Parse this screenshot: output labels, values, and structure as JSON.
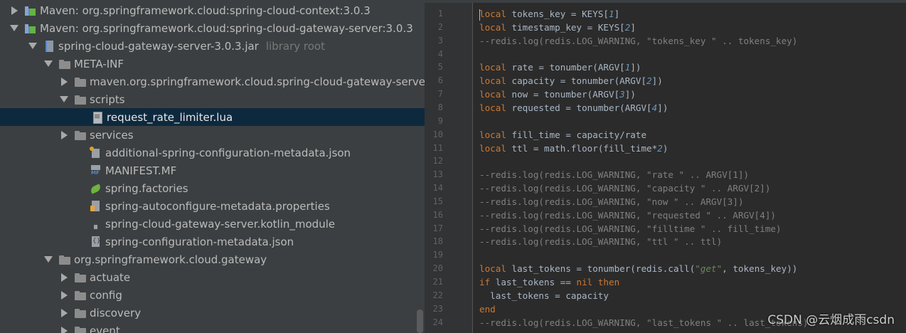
{
  "tree": {
    "rows": [
      {
        "arrow": "collapsed",
        "icon": "library-icon",
        "label": "Maven: org.springframework.cloud:spring-cloud-context:3.0.3",
        "hint": ""
      },
      {
        "arrow": "expanded",
        "icon": "library-icon",
        "label": "Maven: org.springframework.cloud:spring-cloud-gateway-server:3.0.3",
        "hint": ""
      },
      {
        "arrow": "expanded",
        "icon": "jar-icon",
        "label": "spring-cloud-gateway-server-3.0.3.jar",
        "hint": "library root"
      },
      {
        "arrow": "expanded",
        "icon": "folder-icon",
        "label": "META-INF",
        "hint": ""
      },
      {
        "arrow": "collapsed",
        "icon": "folder-icon",
        "label": "maven.org.springframework.cloud.spring-cloud-gateway-server",
        "hint": ""
      },
      {
        "arrow": "expanded",
        "icon": "folder-icon",
        "label": "scripts",
        "hint": ""
      },
      {
        "arrow": "none",
        "icon": "lua-file-icon",
        "label": "request_rate_limiter.lua",
        "hint": "",
        "selected": true
      },
      {
        "arrow": "collapsed",
        "icon": "folder-icon",
        "label": "services",
        "hint": ""
      },
      {
        "arrow": "none",
        "icon": "json-file-icon",
        "label": "additional-spring-configuration-metadata.json",
        "hint": ""
      },
      {
        "arrow": "none",
        "icon": "manifest-file-icon",
        "label": "MANIFEST.MF",
        "hint": ""
      },
      {
        "arrow": "none",
        "icon": "spring-factories-icon",
        "label": "spring.factories",
        "hint": ""
      },
      {
        "arrow": "none",
        "icon": "properties-file-icon",
        "label": "spring-autoconfigure-metadata.properties",
        "hint": ""
      },
      {
        "arrow": "none",
        "icon": "kotlin-module-file-icon",
        "label": "spring-cloud-gateway-server.kotlin_module",
        "hint": ""
      },
      {
        "arrow": "none",
        "icon": "json-config-file-icon",
        "label": "spring-configuration-metadata.json",
        "hint": ""
      },
      {
        "arrow": "expanded",
        "icon": "package-icon",
        "label": "org.springframework.cloud.gateway",
        "hint": ""
      },
      {
        "arrow": "collapsed",
        "icon": "folder-icon",
        "label": "actuate",
        "hint": ""
      },
      {
        "arrow": "collapsed",
        "icon": "folder-icon",
        "label": "config",
        "hint": ""
      },
      {
        "arrow": "collapsed",
        "icon": "folder-icon",
        "label": "discovery",
        "hint": ""
      },
      {
        "arrow": "collapsed",
        "icon": "folder-icon",
        "label": "event",
        "hint": ""
      }
    ]
  },
  "editor": {
    "lines": [
      [
        [
          "k",
          "local"
        ],
        [
          "t",
          " tokens_key = KEYS["
        ],
        [
          "n",
          "1"
        ],
        [
          "t",
          "]"
        ]
      ],
      [
        [
          "k",
          "local"
        ],
        [
          "t",
          " timestamp_key = KEYS["
        ],
        [
          "n",
          "2"
        ],
        [
          "t",
          "]"
        ]
      ],
      [
        [
          "c",
          "--redis.log(redis.LOG_WARNING, \"tokens_key \" .. tokens_key)"
        ]
      ],
      [],
      [
        [
          "k",
          "local"
        ],
        [
          "t",
          " rate = tonumber(ARGV["
        ],
        [
          "n",
          "1"
        ],
        [
          "t",
          "])"
        ]
      ],
      [
        [
          "k",
          "local"
        ],
        [
          "t",
          " capacity = tonumber(ARGV["
        ],
        [
          "n",
          "2"
        ],
        [
          "t",
          "])"
        ]
      ],
      [
        [
          "k",
          "local"
        ],
        [
          "t",
          " now = tonumber(ARGV["
        ],
        [
          "n",
          "3"
        ],
        [
          "t",
          "])"
        ]
      ],
      [
        [
          "k",
          "local"
        ],
        [
          "t",
          " requested = tonumber(ARGV["
        ],
        [
          "n",
          "4"
        ],
        [
          "t",
          "])"
        ]
      ],
      [],
      [
        [
          "k",
          "local"
        ],
        [
          "t",
          " fill_time = capacity/rate"
        ]
      ],
      [
        [
          "k",
          "local"
        ],
        [
          "t",
          " ttl = math.floor(fill_time*"
        ],
        [
          "n",
          "2"
        ],
        [
          "t",
          ")"
        ]
      ],
      [],
      [
        [
          "c",
          "--redis.log(redis.LOG_WARNING, \"rate \" .. ARGV[1])"
        ]
      ],
      [
        [
          "c",
          "--redis.log(redis.LOG_WARNING, \"capacity \" .. ARGV[2])"
        ]
      ],
      [
        [
          "c",
          "--redis.log(redis.LOG_WARNING, \"now \" .. ARGV[3])"
        ]
      ],
      [
        [
          "c",
          "--redis.log(redis.LOG_WARNING, \"requested \" .. ARGV[4])"
        ]
      ],
      [
        [
          "c",
          "--redis.log(redis.LOG_WARNING, \"filltime \" .. fill_time)"
        ]
      ],
      [
        [
          "c",
          "--redis.log(redis.LOG_WARNING, \"ttl \" .. ttl)"
        ]
      ],
      [],
      [
        [
          "k",
          "local"
        ],
        [
          "t",
          " last_tokens = tonumber(redis.call("
        ],
        [
          "s",
          "\"get\""
        ],
        [
          "t",
          ", tokens_key))"
        ]
      ],
      [
        [
          "k",
          "if"
        ],
        [
          "t",
          " last_tokens == "
        ],
        [
          "k",
          "nil"
        ],
        [
          "t",
          " "
        ],
        [
          "k",
          "then"
        ]
      ],
      [
        [
          "t",
          "  last_tokens = capacity"
        ]
      ],
      [
        [
          "k",
          "end"
        ]
      ],
      [
        [
          "c",
          "--redis.log(redis.LOG_WARNING, \"last_tokens \" .. last_tokens)"
        ]
      ]
    ]
  },
  "watermark": "CSDN @云烟成雨csdn"
}
